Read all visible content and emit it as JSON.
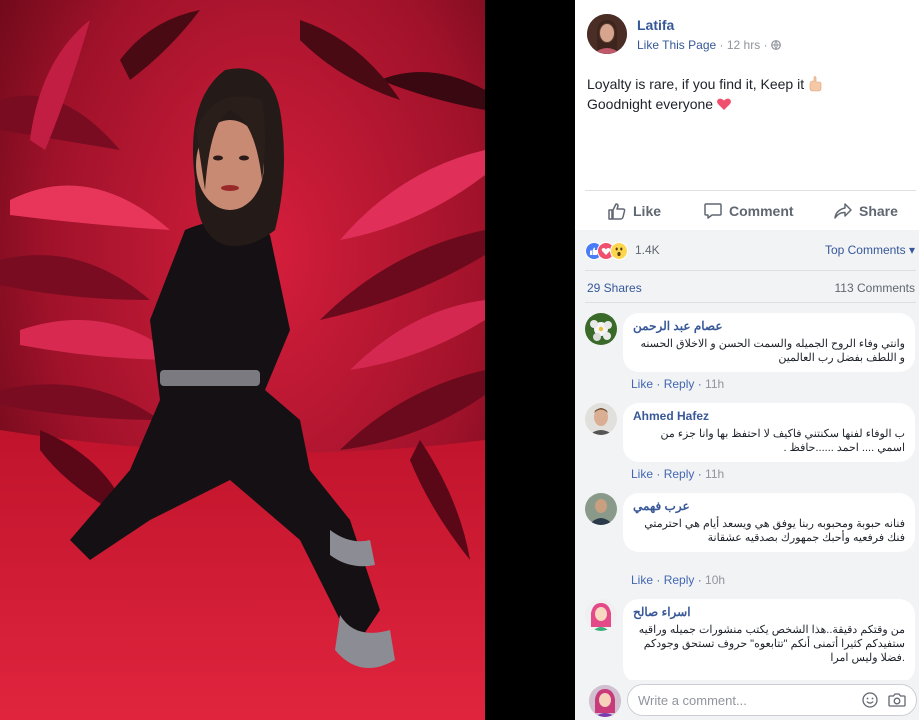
{
  "page": {
    "name": "Latifa",
    "like_label": "Like This Page",
    "time": "12 hrs"
  },
  "post": {
    "line1": "Loyalty is rare, if you find it, Keep it",
    "line2": "Goodnight everyone"
  },
  "actions": {
    "like": "Like",
    "comment": "Comment",
    "share": "Share"
  },
  "reactions": {
    "count": "1.4K",
    "sort_label": "Top Comments ▾",
    "icons": [
      "like-icon",
      "love-icon",
      "wow-icon"
    ]
  },
  "stats": {
    "shares": "29 Shares",
    "comments": "113 Comments"
  },
  "comments": [
    {
      "name": "عصام عبد الرحمن",
      "text": "وانتي وفاء الروح الجميله والسمت الحسن و الاخلاق الحسنه و اللطف بفضل رب العالمين",
      "like": "Like",
      "reply": "Reply",
      "time": "11h"
    },
    {
      "name": "Ahmed Hafez",
      "text": "ب الوفاء لفنها سكنتني فاكيف لا احتفظ بها وانا جزء من اسمي .... احمد ......حافظ .",
      "like": "Like",
      "reply": "Reply",
      "time": "11h"
    },
    {
      "name": "عرب فهمي",
      "text": "فنانه حبوبة ومحبوبه ربنا يوفق هي ويسعد أيام هي احترمتي فنك فرفعيه وأحبك جمهورك بصدقيه عشقانة",
      "like": "Like",
      "reply": "Reply",
      "time": "10h"
    },
    {
      "name": "اسراء صالح",
      "text": "من وقتكم دقيقة..هذا الشخص يكتب منشورات جميله وراقيه ستفيدكم كثيرا أتمنى أنكم \"تتابعوه\" حروف تستحق وجودكم .فضلا وليس امرا"
    }
  ],
  "composer": {
    "placeholder": "Write a comment..."
  },
  "colors": {
    "link": "#365899",
    "grey_bg": "#f2f3f5",
    "photo_red": "#b0102a"
  }
}
